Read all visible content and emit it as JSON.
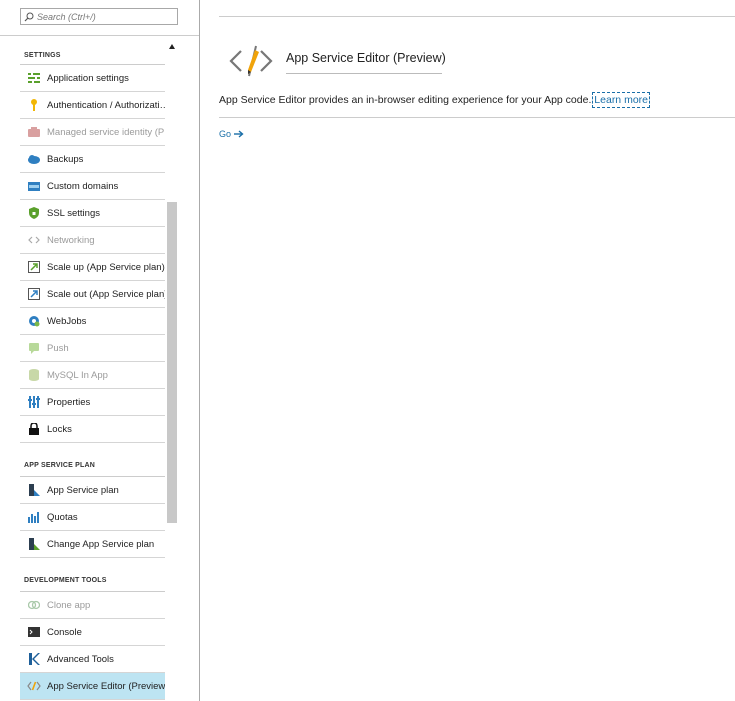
{
  "search": {
    "placeholder": "Search (Ctrl+/)"
  },
  "sidebar": {
    "sections": [
      {
        "title": "SETTINGS",
        "items": [
          {
            "label": "Application settings",
            "icon": "settings-list-icon",
            "disabled": false
          },
          {
            "label": "Authentication / Authorizati…",
            "icon": "key-icon",
            "disabled": false
          },
          {
            "label": "Managed service identity (P…",
            "icon": "identity-icon",
            "disabled": true
          },
          {
            "label": "Backups",
            "icon": "backup-icon",
            "disabled": false
          },
          {
            "label": "Custom domains",
            "icon": "domain-icon",
            "disabled": false
          },
          {
            "label": "SSL settings",
            "icon": "shield-icon",
            "disabled": false
          },
          {
            "label": "Networking",
            "icon": "networking-icon",
            "disabled": true
          },
          {
            "label": "Scale up (App Service plan)",
            "icon": "scale-up-icon",
            "disabled": false
          },
          {
            "label": "Scale out (App Service plan)",
            "icon": "scale-out-icon",
            "disabled": false
          },
          {
            "label": "WebJobs",
            "icon": "webjobs-icon",
            "disabled": false
          },
          {
            "label": "Push",
            "icon": "push-icon",
            "disabled": true
          },
          {
            "label": "MySQL In App",
            "icon": "mysql-icon",
            "disabled": true
          },
          {
            "label": "Properties",
            "icon": "properties-icon",
            "disabled": false
          },
          {
            "label": "Locks",
            "icon": "lock-icon",
            "disabled": false
          }
        ]
      },
      {
        "title": "APP SERVICE PLAN",
        "items": [
          {
            "label": "App Service plan",
            "icon": "app-service-plan-icon",
            "disabled": false
          },
          {
            "label": "Quotas",
            "icon": "quotas-icon",
            "disabled": false
          },
          {
            "label": "Change App Service plan",
            "icon": "change-plan-icon",
            "disabled": false
          }
        ]
      },
      {
        "title": "DEVELOPMENT TOOLS",
        "items": [
          {
            "label": "Clone app",
            "icon": "clone-icon",
            "disabled": true
          },
          {
            "label": "Console",
            "icon": "console-icon",
            "disabled": false
          },
          {
            "label": "Advanced Tools",
            "icon": "kudu-icon",
            "disabled": false
          },
          {
            "label": "App Service Editor (Preview)",
            "icon": "code-editor-icon",
            "disabled": false,
            "selected": true
          }
        ]
      }
    ]
  },
  "main": {
    "title": "App Service Editor (Preview)",
    "description": "App Service Editor provides an in-browser editing experience for your App code.",
    "learn_more": "Learn more",
    "go_label": "Go"
  },
  "colors": {
    "link": "#1a6fa8",
    "selected_bg": "#bde4f2",
    "disabled_text": "#9b9b9b",
    "pencil": "#f0a30a"
  }
}
